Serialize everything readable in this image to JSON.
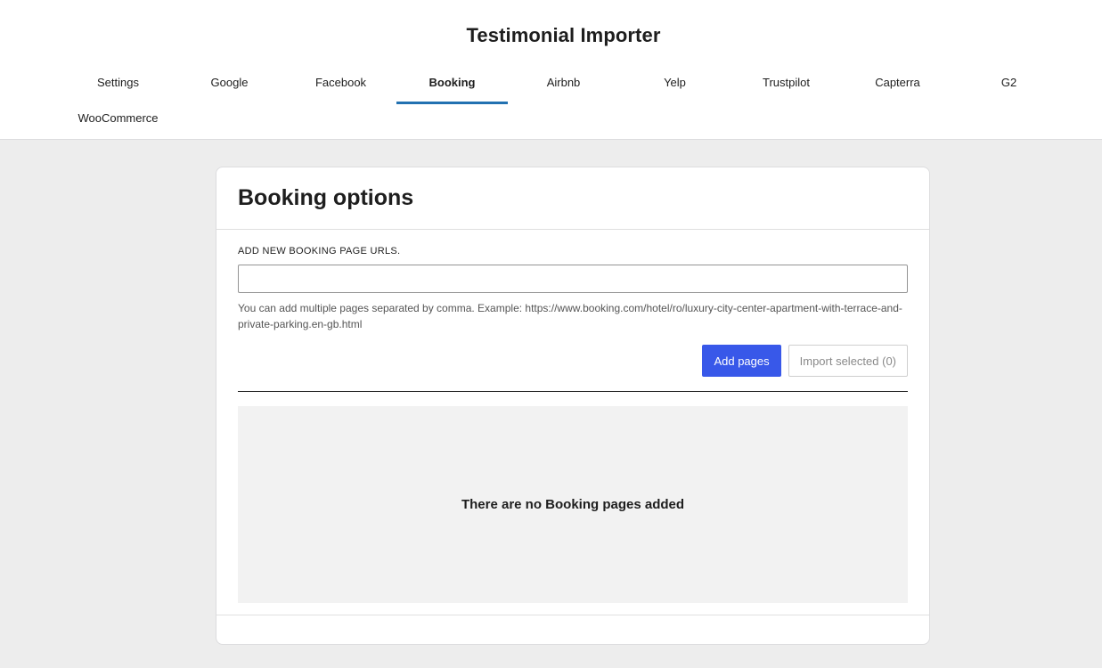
{
  "app": {
    "title": "Testimonial Importer"
  },
  "tabs": [
    {
      "label": "Settings"
    },
    {
      "label": "Google"
    },
    {
      "label": "Facebook"
    },
    {
      "label": "Booking",
      "active": true
    },
    {
      "label": "Airbnb"
    },
    {
      "label": "Yelp"
    },
    {
      "label": "Trustpilot"
    },
    {
      "label": "Capterra"
    },
    {
      "label": "G2"
    },
    {
      "label": "WooCommerce"
    }
  ],
  "card": {
    "title": "Booking options",
    "field_label": "ADD NEW BOOKING PAGE URLS.",
    "input_value": "",
    "help_text": "You can add multiple pages separated by comma. Example: https://www.booking.com/hotel/ro/luxury-city-center-apartment-with-terrace-and-private-parking.en-gb.html",
    "add_button": "Add pages",
    "import_button": "Import selected (0)",
    "empty_message": "There are no Booking pages added"
  },
  "colors": {
    "accent": "#2271b1",
    "primary_button": "#3858e9",
    "page_background": "#ededed"
  }
}
